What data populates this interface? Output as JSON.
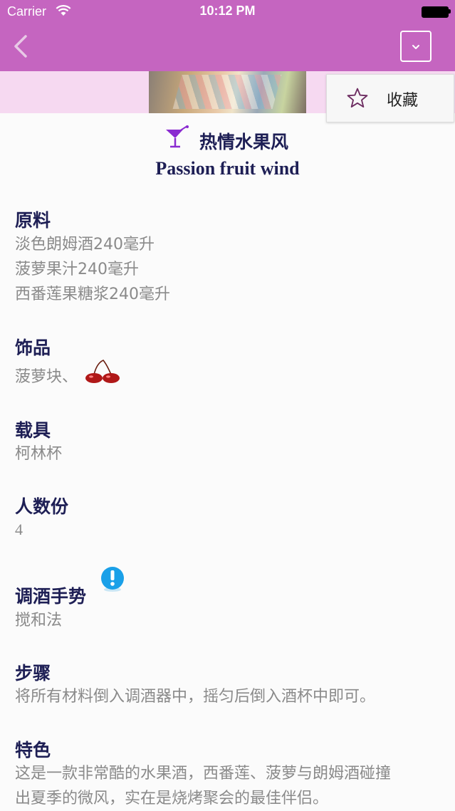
{
  "status": {
    "carrier": "Carrier",
    "time": "10:12 PM"
  },
  "popup": {
    "favorite_label": "收藏"
  },
  "drink": {
    "name_cn": "热情水果风",
    "name_en": "Passion fruit wind"
  },
  "sections": {
    "ingredients": {
      "label": "原料",
      "items": [
        "淡色朗姆酒240毫升",
        "菠萝果汁240毫升",
        "西番莲果糖浆240毫升"
      ]
    },
    "garnish": {
      "label": "饰品",
      "value": "菠萝块、"
    },
    "glass": {
      "label": "载具",
      "value": "柯林杯"
    },
    "servings": {
      "label": "人数份",
      "value": "4"
    },
    "technique": {
      "label": "调酒手势",
      "value": "搅和法"
    },
    "steps": {
      "label": "步骤",
      "value": "将所有材料倒入调酒器中，摇匀后倒入酒杯中即可。"
    },
    "feature": {
      "label": "特色",
      "lines": [
        "这是一款非常酷的水果酒，西番莲、菠萝与朗姆酒碰撞",
        "出夏季的微风，实在是烧烤聚会的最佳伴侣。"
      ]
    }
  },
  "colors": {
    "header": "#c565c0",
    "banner": "#f6d9f1",
    "heading": "#1e1f55",
    "body_text": "#8a8a8a"
  },
  "icons": [
    "wifi-icon",
    "battery-icon",
    "back-chevron-icon",
    "chevron-down-icon",
    "star-icon",
    "cocktail-glass-icon",
    "cherry-icon",
    "info-alert-icon"
  ]
}
